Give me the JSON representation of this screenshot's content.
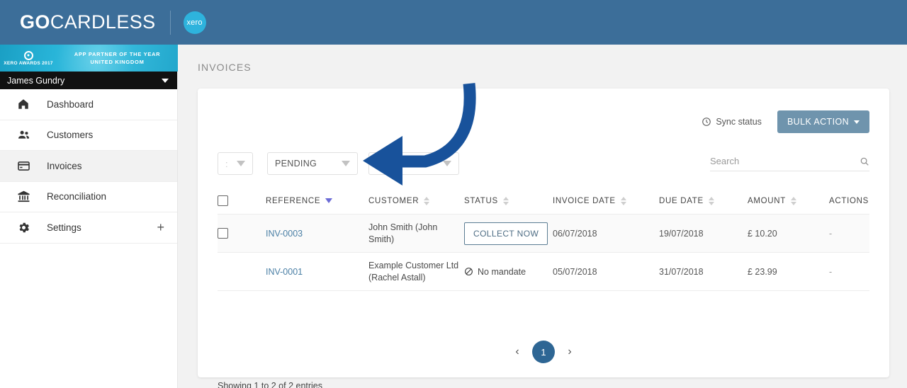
{
  "header": {
    "brand_go": "GO",
    "brand_cardless": "CARDLESS",
    "partner_badge": "xero"
  },
  "sidebar": {
    "award_banner": {
      "left_text": "XERO AWARDS 2017",
      "line1": "APP PARTNER OF THE YEAR",
      "line2": "UNITED KINGDOM"
    },
    "user": {
      "name": "James Gundry"
    },
    "items": [
      {
        "label": "Dashboard",
        "icon": "home-icon",
        "active": false
      },
      {
        "label": "Customers",
        "icon": "people-icon",
        "active": false
      },
      {
        "label": "Invoices",
        "icon": "credit-card-icon",
        "active": true
      },
      {
        "label": "Reconciliation",
        "icon": "bank-icon",
        "active": false
      },
      {
        "label": "Settings",
        "icon": "gear-icon",
        "active": false,
        "suffix": "+"
      }
    ]
  },
  "main": {
    "page_title": "INVOICES",
    "toolbar": {
      "sync_status_label": "Sync status",
      "sync_icon": "clock-icon",
      "bulk_action_label": "BULK ACTION"
    },
    "filters": {
      "page_size_value": ":",
      "status_value": "PENDING",
      "extra_value": ""
    },
    "search": {
      "placeholder": "Search",
      "value": "",
      "icon": "search-icon"
    },
    "table": {
      "columns": [
        {
          "label": "REFERENCE",
          "sort": "desc"
        },
        {
          "label": "CUSTOMER",
          "sort": "none"
        },
        {
          "label": "STATUS",
          "sort": "none"
        },
        {
          "label": "INVOICE DATE",
          "sort": "none"
        },
        {
          "label": "DUE DATE",
          "sort": "none"
        },
        {
          "label": "AMOUNT",
          "sort": "none"
        },
        {
          "label": "ACTIONS",
          "sort": "none"
        }
      ],
      "rows": [
        {
          "has_checkbox": true,
          "reference": "INV-0003",
          "customer": "John Smith (John Smith)",
          "status_type": "button",
          "status_label": "COLLECT NOW",
          "invoice_date": "06/07/2018",
          "due_date": "19/07/2018",
          "amount": "£ 10.20",
          "actions": "-"
        },
        {
          "has_checkbox": false,
          "reference": "INV-0001",
          "customer": "Example Customer Ltd (Rachel Astall)",
          "status_type": "text",
          "status_label": "No mandate",
          "status_icon": "ban-icon",
          "invoice_date": "05/07/2018",
          "due_date": "31/07/2018",
          "amount": "£ 23.99",
          "actions": "-"
        }
      ]
    },
    "pagination": {
      "prev": "‹",
      "current_page": "1",
      "next": "›"
    },
    "showing_text": "Showing 1 to 2 of 2 entries"
  },
  "annotation": {
    "arrow_color": "#18529b"
  },
  "colors": {
    "topbar": "#3c6e99",
    "accent_blue": "#2e6694",
    "bulk_button": "#6f94ad",
    "link": "#4a7fa5",
    "sort_active": "#6c6cd6"
  }
}
